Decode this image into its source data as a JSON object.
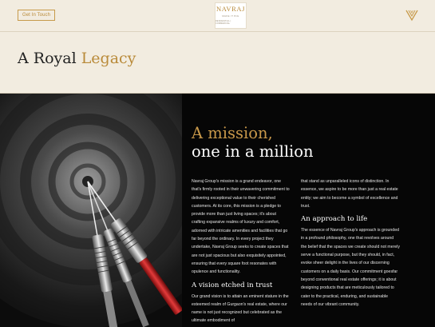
{
  "header": {
    "cta_label": "Get In Touch",
    "logo": {
      "name": "NAVRAJ",
      "tagline": "MAKE IT BIG",
      "sub": "RESIDENTIAL | COMMERCIAL"
    },
    "mark_icon": "navraj-v-mark-icon"
  },
  "hero": {
    "title_part1": "A Royal ",
    "title_part2": "Legacy"
  },
  "mission": {
    "title_line1": "A mission,",
    "title_line2": "one in a million",
    "col1_para1": "Navraj Group's mission is a grand endeavor, one that's firmly rooted in their unwavering commitment to delivering exceptional value to their cherished customers. At its core, this mission is a pledge to provide more than just living spaces; it's about crafting expansive realms of luxury and comfort, adorned with intricate amenities and facilities that go far beyond the ordinary. In every project they undertake, Navraj Group seeks to create spaces that are not just spacious but also exquisitely appointed, ensuring that every square foot resonates with opulence and functionality.",
    "vision_heading": "A vision etched in trust",
    "col1_para2": "Our grand vision is to attain an eminent stature in the esteemed realm of Gurgaon's real estate, where our name is not just recognized but celebrated as the ultimate embodiment of",
    "col2_para1": "that stand as unparalleled icons of distinction. In essence, we aspire to be more than just a real estate entity; we aim to become a symbol of excellence and trust.",
    "approach_heading": "An approach to life",
    "col2_para2": "The essence of Navraj Group's approach is grounded in a profound philosophy, one that revolves around the belief that the spaces we create should not merely serve a functional purpose, but they should, in fact, evoke sheer delight in the lives of our discerning customers on a daily basis. Our commitment goesfar beyond conventional real estate offerings; it is about designing products that are meticulously tailored to cater to the practical, enduring, and sustainable needs of our vibrant community."
  },
  "colors": {
    "gold": "#b98a39",
    "cream": "#f2ece0",
    "dark": "#060606"
  }
}
